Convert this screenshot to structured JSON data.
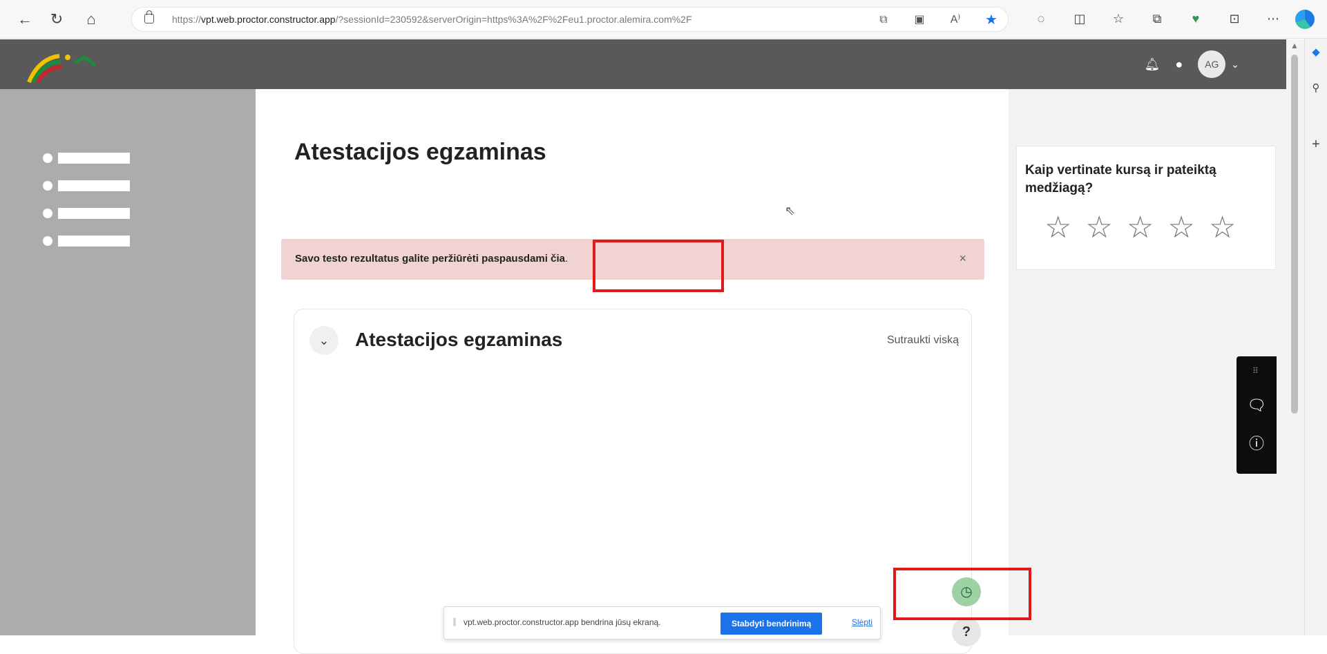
{
  "browser": {
    "url_prefix": "https://",
    "url_host": "vpt.web.proctor.constructor.app",
    "url_rest": "/?sessionId=230592&serverOrigin=https%3A%2F%2Feu1.proctor.alemira.com%2F",
    "nav": [
      "back-icon",
      "refresh-icon",
      "home-icon"
    ],
    "address_icons": [
      "app-available-icon",
      "tab-action-icon",
      "read-aloud-icon",
      "favorite-star-icon"
    ],
    "toolbar_icons": [
      "copilot-icon",
      "split-screen-icon",
      "favorites-icon",
      "collections-icon",
      "browser-essentials-icon",
      "screenshot-icon",
      "more-icon"
    ]
  },
  "header": {
    "avatar_initials": "AG",
    "icons": [
      "bell-icon",
      "chat-icon",
      "chevron-down-icon"
    ]
  },
  "main": {
    "page_title": "Atestacijos egzaminas",
    "alert": {
      "text": "Savo testo rezultatus galite peržiūrėti paspausdami ",
      "link": "čia",
      "tail": ".",
      "close": "×"
    },
    "section": {
      "title": "Atestacijos egzaminas",
      "collapse_all": "Sutraukti viską"
    }
  },
  "rating": {
    "question": "Kaip vertinate kursą ir pateiktą medžiagą?",
    "stars": 5,
    "selected": 0
  },
  "screen_share": {
    "message": "vpt.web.proctor.constructor.app bendrina jūsų ekraną.",
    "stop_label": "Stabdyti bendrinimą",
    "hide_label": "Slėpti"
  },
  "help": {
    "label": "?"
  },
  "colors": {
    "header_bg": "#595959",
    "nav_bg": "#acacac",
    "alert_bg": "#f1d4d1",
    "timer_bg": "#9ed2a4",
    "highlight": "#e01919",
    "accent_blue": "#1a73e8"
  }
}
